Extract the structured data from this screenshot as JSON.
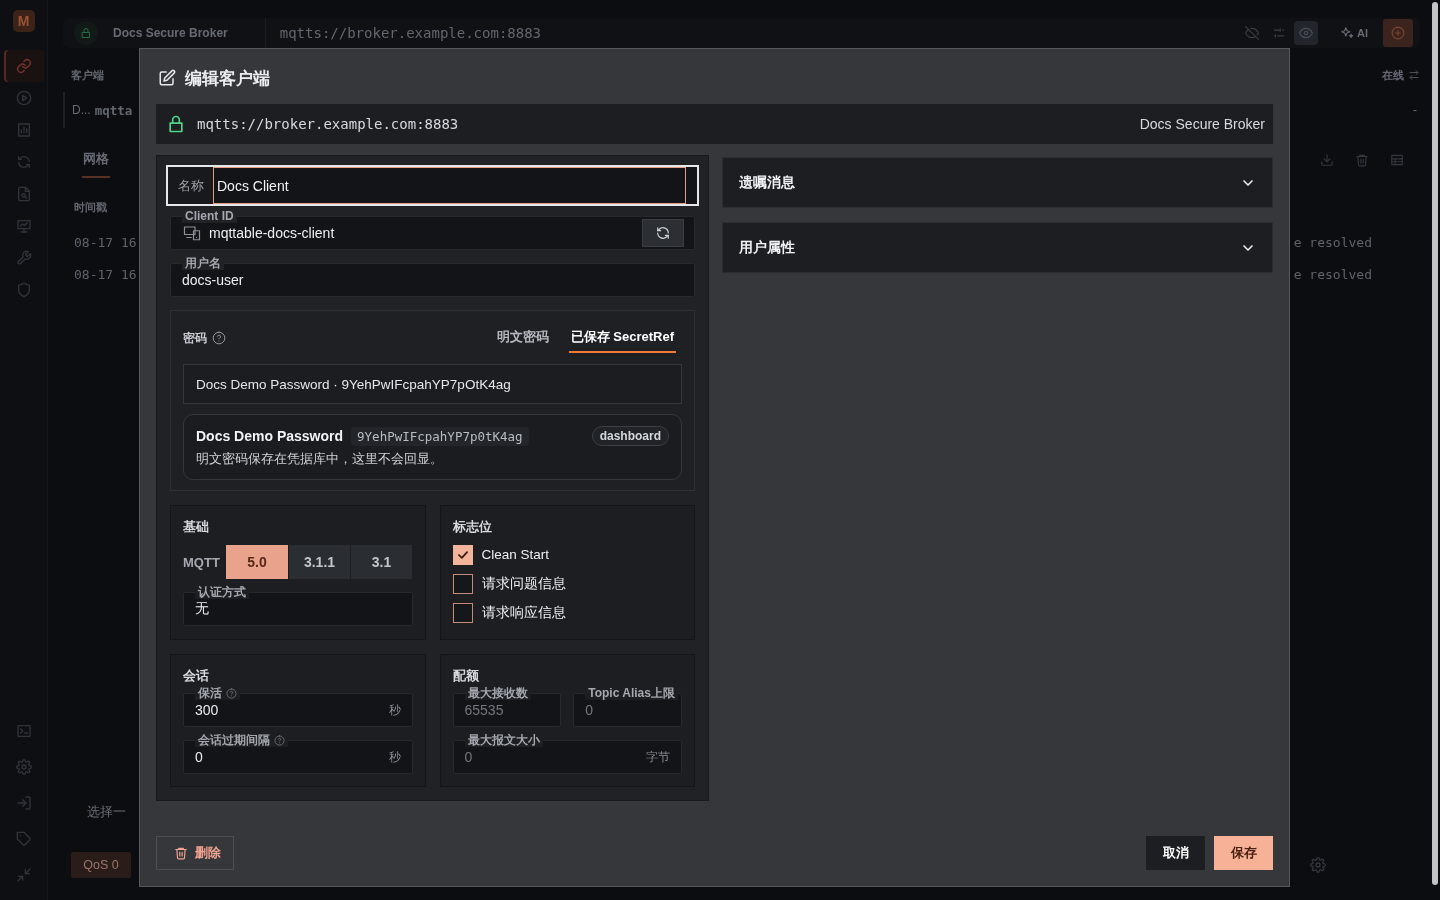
{
  "app": {
    "logo": "M",
    "rail": [
      {
        "selected": true
      },
      {
        "selected": false
      },
      {
        "selected": false
      },
      {
        "selected": false
      },
      {
        "selected": false
      },
      {
        "selected": false
      },
      {
        "selected": false
      },
      {
        "selected": false
      }
    ],
    "topbar": {
      "broker_name": "Docs Secure Broker",
      "url": "mqtts://broker.example.com:8883",
      "toolbar": [
        {
          "on": false
        },
        {
          "on": false
        },
        {
          "on": true
        }
      ],
      "ai_label": "AI"
    },
    "clients": {
      "title": "客户端",
      "status": "在线",
      "row": {
        "name": "D...",
        "client_id": "mqtta",
        "value": "-"
      }
    },
    "tabs": [
      {
        "label": "网格",
        "selected": true
      }
    ],
    "table": {
      "columns": [
        "时间戳"
      ],
      "rows": [
        {
          "time": "08-17 16",
          "detail": "e resolved"
        },
        {
          "time": "08-17 16",
          "detail": "e resolved"
        }
      ]
    },
    "composer": {
      "placeholder": "选择一",
      "qos": "QoS 0"
    }
  },
  "dialog": {
    "title": "编辑客户端",
    "broker": {
      "url": "mqtts://broker.example.com:8883",
      "name": "Docs Secure Broker"
    },
    "name_field": {
      "label": "名称",
      "value": "Docs Client",
      "focused": true
    },
    "client_id": {
      "label": "Client ID",
      "value": "mqttable-docs-client"
    },
    "username": {
      "label": "用户名",
      "value": "docs-user"
    },
    "password": {
      "label": "密码",
      "modes": [
        {
          "label": "明文密码",
          "selected": false
        },
        {
          "label": "已保存 SecretRef",
          "selected": true
        }
      ],
      "secret_value": "Docs Demo Password · 9YehPwIFcpahYP7pOtK4ag",
      "secret": {
        "name": "Docs Demo Password",
        "ref": "9YehPwIFcpahYP7p0tK4ag",
        "tag": "dashboard",
        "note": "明文密码保存在凭据库中，这里不会回显。"
      }
    },
    "basics": {
      "title": "基础",
      "protocol": "MQTT",
      "versions": [
        {
          "label": "5.0",
          "selected": true
        },
        {
          "label": "3.1.1",
          "selected": false
        },
        {
          "label": "3.1",
          "selected": false
        }
      ],
      "auth": {
        "label": "认证方式",
        "value": "无"
      }
    },
    "flags": {
      "title": "标志位",
      "items": [
        {
          "label": "Clean Start",
          "checked": true
        },
        {
          "label": "请求问题信息",
          "checked": false
        },
        {
          "label": "请求响应信息",
          "checked": false
        }
      ]
    },
    "session": {
      "title": "会话",
      "fields": [
        {
          "label": "保活",
          "help": true,
          "value": "300",
          "unit": "秒"
        },
        {
          "label": "会话过期间隔",
          "help": true,
          "value": "0",
          "unit": "秒"
        }
      ]
    },
    "quota": {
      "title": "配额",
      "fields": [
        {
          "label": "最大接收数",
          "placeholder": "65535"
        },
        {
          "label": "Topic Alias上限",
          "placeholder": "0"
        },
        {
          "label": "最大报文大小",
          "placeholder": "0",
          "unit": "字节"
        }
      ]
    },
    "sections": [
      {
        "title": "遗嘱消息",
        "expanded": false
      },
      {
        "title": "用户属性",
        "expanded": false
      }
    ],
    "actions": {
      "delete": "删除",
      "cancel": "取消",
      "save": "保存"
    }
  }
}
